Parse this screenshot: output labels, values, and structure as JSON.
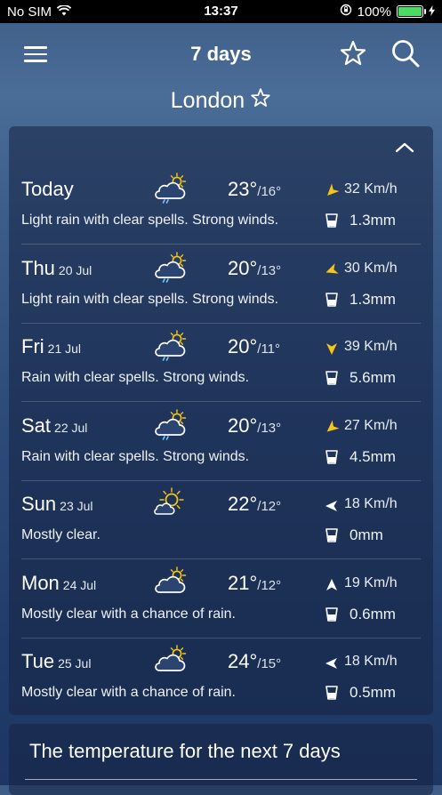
{
  "status_bar": {
    "carrier": "No SIM",
    "time": "13:37",
    "battery": "100%"
  },
  "header": {
    "title": "7 days"
  },
  "location": {
    "city": "London"
  },
  "forecast": [
    {
      "day": "Today",
      "date": "",
      "high": "23°",
      "low": "16°",
      "wind": "32 Km/h",
      "wind_rotation": 225,
      "description": "Light rain with clear spells. Strong winds.",
      "rain": "1.3mm",
      "icon": "cloud-sun-rain-icon"
    },
    {
      "day": "Thu",
      "date": "20 Jul",
      "high": "20°",
      "low": "13°",
      "wind": "30 Km/h",
      "wind_rotation": 250,
      "description": "Light rain with clear spells. Strong winds.",
      "rain": "1.3mm",
      "icon": "cloud-sun-rain-icon"
    },
    {
      "day": "Fri",
      "date": "21 Jul",
      "high": "20°",
      "low": "11°",
      "wind": "39 Km/h",
      "wind_rotation": 180,
      "description": "Rain with clear spells. Strong winds.",
      "rain": "5.6mm",
      "icon": "cloud-sun-rain-icon"
    },
    {
      "day": "Sat",
      "date": "22 Jul",
      "high": "20°",
      "low": "13°",
      "wind": "27 Km/h",
      "wind_rotation": 230,
      "description": "Rain with clear spells. Strong winds.",
      "rain": "4.5mm",
      "icon": "cloud-sun-rain-icon"
    },
    {
      "day": "Sun",
      "date": "23 Jul",
      "high": "22°",
      "low": "12°",
      "wind": "18 Km/h",
      "wind_rotation": 270,
      "description": "Mostly clear.",
      "rain": "0mm",
      "icon": "sun-cloud-icon"
    },
    {
      "day": "Mon",
      "date": "24 Jul",
      "high": "21°",
      "low": "12°",
      "wind": "19 Km/h",
      "wind_rotation": 0,
      "description": "Mostly clear with a chance of rain.",
      "rain": "0.6mm",
      "icon": "cloud-sun-icon"
    },
    {
      "day": "Tue",
      "date": "25 Jul",
      "high": "24°",
      "low": "15°",
      "wind": "18 Km/h",
      "wind_rotation": 270,
      "description": "Mostly clear with a chance of rain.",
      "rain": "0.5mm",
      "icon": "cloud-sun-icon"
    }
  ],
  "temperature_section": {
    "title": "The temperature for the next 7 days"
  },
  "colors": {
    "accent_yellow": "#f5c518",
    "background_blue": "#2c4a79"
  }
}
